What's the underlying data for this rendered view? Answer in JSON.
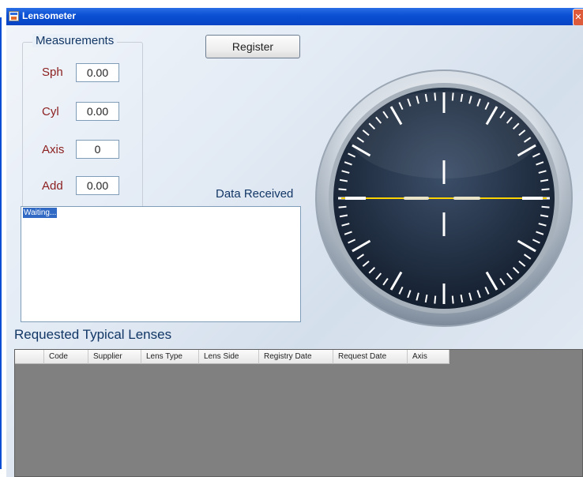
{
  "window": {
    "title": "Lensometer",
    "close_glyph": "✕"
  },
  "measurements": {
    "title": "Measurements",
    "sph": {
      "label": "Sph",
      "value": "0.00"
    },
    "cyl": {
      "label": "Cyl",
      "value": "0.00"
    },
    "axis": {
      "label": "Axis",
      "value": "0"
    },
    "add": {
      "label": "Add",
      "value": "0.00"
    }
  },
  "register_label": "Register",
  "data_received": {
    "label": "Data Received",
    "text": "Waiting..."
  },
  "lenses": {
    "title": "Requested Typical Lenses",
    "columns": [
      "",
      "Code",
      "Supplier",
      "Lens Type",
      "Lens Side",
      "Registry Date",
      "Request Date",
      "Axis"
    ]
  },
  "gauge": {
    "icon": "lensometer-dial-icon",
    "axis_line_color": "#ffd200",
    "face_color": "#1c2b40"
  },
  "colors": {
    "titlebar": "#0a4fd3",
    "label_red": "#8b1e1e",
    "heading_blue": "#123766",
    "grid_bg": "#808080"
  }
}
